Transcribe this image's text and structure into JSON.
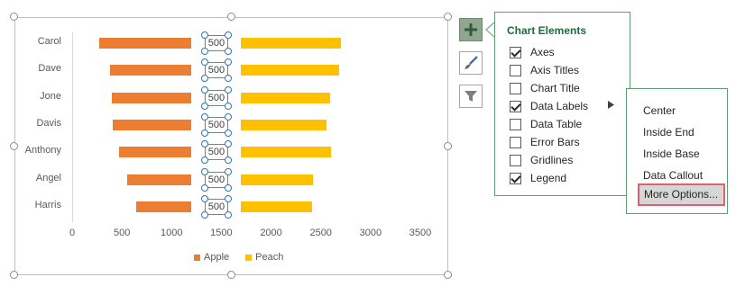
{
  "chart": {
    "categories": [
      "Carol",
      "Dave",
      "Jone",
      "Davis",
      "Anthony",
      "Angel",
      "Harris"
    ],
    "x_ticks": [
      "0",
      "500",
      "1000",
      "1500",
      "2000",
      "2500",
      "3000",
      "3500"
    ],
    "data_label": "500",
    "legend": {
      "apple": "Apple",
      "peach": "Peach"
    },
    "colors": {
      "apple": "#ed7d31",
      "peach": "#ffc000"
    }
  },
  "chart_data": {
    "type": "bar",
    "orientation": "horizontal",
    "categories": [
      "Carol",
      "Dave",
      "Jone",
      "Davis",
      "Anthony",
      "Angel",
      "Harris"
    ],
    "series": [
      {
        "name": "Apple",
        "values": [
          930,
          820,
          800,
          790,
          730,
          650,
          560
        ]
      },
      {
        "name": "Peach",
        "values": [
          1000,
          980,
          890,
          860,
          900,
          720,
          710
        ]
      }
    ],
    "gap_series_values": [
      500,
      500,
      500,
      500,
      500,
      500,
      500
    ],
    "xlim": [
      0,
      3500
    ],
    "legend_position": "bottom"
  },
  "side_buttons": {
    "elements": "plus-icon",
    "styles": "brush-icon",
    "filters": "filter-icon"
  },
  "panel": {
    "title": "Chart Elements",
    "options": [
      {
        "label": "Axes",
        "checked": true
      },
      {
        "label": "Axis Titles",
        "checked": false
      },
      {
        "label": "Chart Title",
        "checked": false
      },
      {
        "label": "Data Labels",
        "checked": true
      },
      {
        "label": "Data Table",
        "checked": false
      },
      {
        "label": "Error Bars",
        "checked": false
      },
      {
        "label": "Gridlines",
        "checked": false
      },
      {
        "label": "Legend",
        "checked": true
      }
    ]
  },
  "submenu": {
    "items": [
      "Center",
      "Inside End",
      "Inside Base",
      "Data Callout"
    ],
    "more": "More Options..."
  }
}
